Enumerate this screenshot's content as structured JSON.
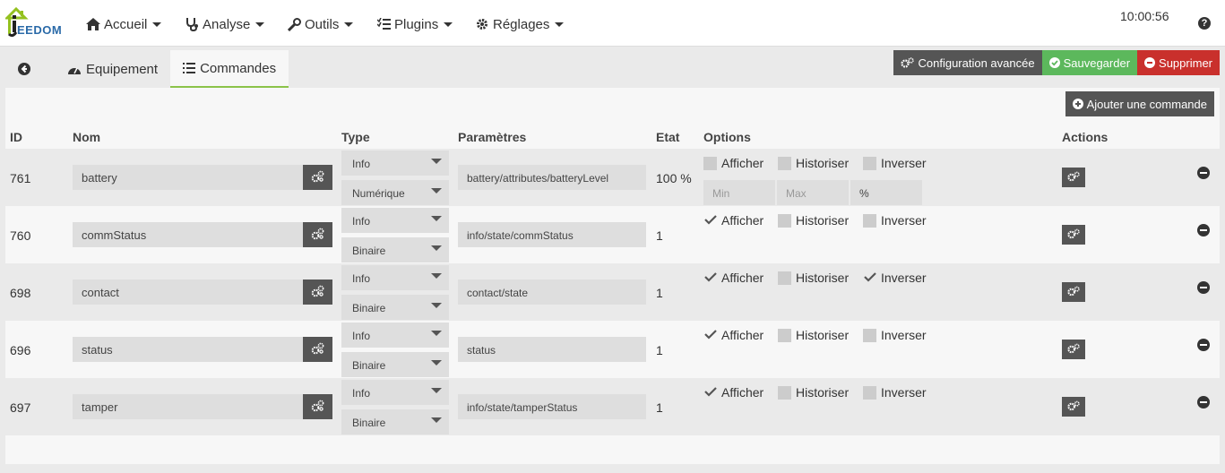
{
  "navbar": {
    "logo_text": "EEDOM",
    "menus": [
      {
        "label": "Accueil",
        "icon": "home-icon"
      },
      {
        "label": "Analyse",
        "icon": "stethoscope-icon"
      },
      {
        "label": "Outils",
        "icon": "wrench-icon"
      },
      {
        "label": "Plugins",
        "icon": "tasks-icon"
      },
      {
        "label": "Réglages",
        "icon": "gear-icon"
      }
    ],
    "clock": "10:00:56",
    "help": "?"
  },
  "tabs": [
    {
      "label": "",
      "icon": "back-arrow-icon"
    },
    {
      "label": "Equipement",
      "icon": "tachometer-icon"
    },
    {
      "label": "Commandes",
      "icon": "list-icon",
      "active": true
    }
  ],
  "actions": {
    "advanced": "Configuration avancée",
    "save": "Sauvegarder",
    "delete": "Supprimer",
    "add_command": "Ajouter une commande"
  },
  "table": {
    "headers": {
      "id": "ID",
      "name": "Nom",
      "type": "Type",
      "params": "Paramètres",
      "state": "Etat",
      "options": "Options",
      "actions": "Actions"
    },
    "option_labels": {
      "show": "Afficher",
      "history": "Historiser",
      "invert": "Inverser"
    },
    "minmax_placeholders": {
      "min": "Min",
      "max": "Max"
    },
    "rows": [
      {
        "id": "761",
        "name": "battery",
        "type": "Info",
        "subtype": "Numérique",
        "param": "battery/attributes/batteryLevel",
        "state": "100 %",
        "show": false,
        "history": false,
        "invert": false,
        "unit": "%"
      },
      {
        "id": "760",
        "name": "commStatus",
        "type": "Info",
        "subtype": "Binaire",
        "param": "info/state/commStatus",
        "state": "1",
        "show": true,
        "history": false,
        "invert": false
      },
      {
        "id": "698",
        "name": "contact",
        "type": "Info",
        "subtype": "Binaire",
        "param": "contact/state",
        "state": "1",
        "show": true,
        "history": false,
        "invert": true
      },
      {
        "id": "696",
        "name": "status",
        "type": "Info",
        "subtype": "Binaire",
        "param": "status",
        "state": "1",
        "show": true,
        "history": false,
        "invert": false
      },
      {
        "id": "697",
        "name": "tamper",
        "type": "Info",
        "subtype": "Binaire",
        "param": "info/state/tamperStatus",
        "state": "1",
        "show": true,
        "history": false,
        "invert": false
      }
    ]
  },
  "colors": {
    "accent_green": "#5cb85c",
    "danger_red": "#c9302c",
    "dark_grey": "#555555",
    "tab_underline": "#8bc34a"
  }
}
